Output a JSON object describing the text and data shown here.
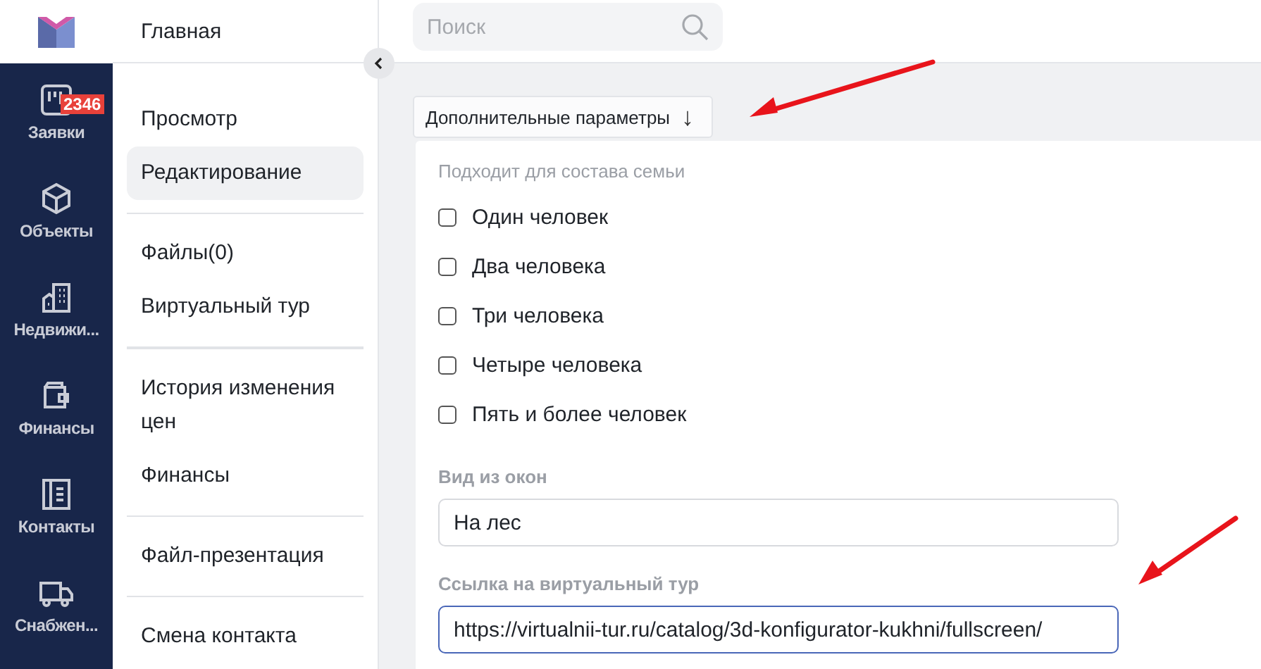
{
  "rail": {
    "items": [
      {
        "label": "Заявки",
        "badge": "2346",
        "selected": false
      },
      {
        "label": "Объекты",
        "selected": false
      },
      {
        "label": "Недвижи...",
        "selected": false
      },
      {
        "label": "Финансы",
        "selected": false
      },
      {
        "label": "Контакты",
        "selected": false
      },
      {
        "label": "Снабжен...",
        "selected": false
      }
    ]
  },
  "sidebar": {
    "title": "Главная",
    "groups": [
      [
        {
          "label": "Просмотр",
          "selected": false
        },
        {
          "label": "Редактирование",
          "selected": true
        }
      ],
      [
        {
          "label": "Файлы(0)",
          "selected": false
        },
        {
          "label": "Виртуальный тур",
          "selected": false
        }
      ],
      [
        {
          "label": "История изменения цен",
          "selected": false
        },
        {
          "label": "Финансы",
          "selected": false
        }
      ],
      [
        {
          "label": "Файл-презентация",
          "selected": false
        }
      ],
      [
        {
          "label": "Смена контакта",
          "selected": false
        }
      ]
    ]
  },
  "search": {
    "placeholder": "Поиск"
  },
  "extra_params": {
    "label": "Дополнительные параметры",
    "arrow": "↓"
  },
  "card": {
    "family_label": "Подходит для состава семьи",
    "checkboxes": [
      {
        "label": "Один человек",
        "checked": false
      },
      {
        "label": "Два человека",
        "checked": false
      },
      {
        "label": "Три человека",
        "checked": false
      },
      {
        "label": "Четыре человека",
        "checked": false
      },
      {
        "label": "Пять и более человек",
        "checked": false
      }
    ],
    "fields": [
      {
        "label": "Вид из окон",
        "value": "На лес",
        "focused": false
      },
      {
        "label": "Ссылка на виртуальный тур",
        "value": "https://virtualnii-tur.ru/catalog/3d-konfigurator-kukhni/fullscreen/",
        "focused": true
      }
    ]
  }
}
